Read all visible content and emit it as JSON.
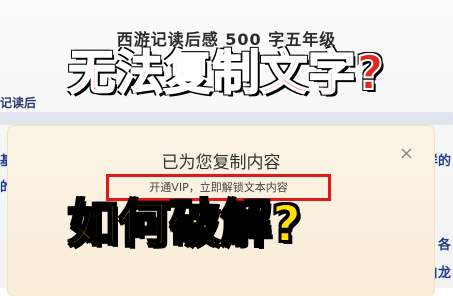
{
  "document": {
    "title": "西游记读后感 500 字五年级",
    "fragment_left": "记读后",
    "edge_left": [
      "基",
      "的"
    ],
    "edge_right": [
      "样的",
      "各",
      "白龙"
    ]
  },
  "overlay": {
    "headline": "无法复制文字?",
    "question": "如何破解?"
  },
  "modal": {
    "title": "已为您复制内容",
    "close_icon": "×",
    "subtext": "开通VIP，立即解锁文本内容"
  },
  "colors": {
    "headline": "#e3261e",
    "question": "#ffe000",
    "highlight_border": "#e21919"
  }
}
